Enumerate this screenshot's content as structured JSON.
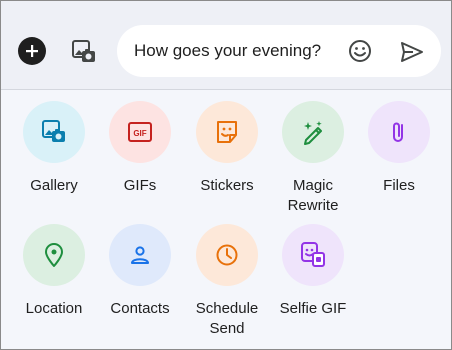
{
  "compose": {
    "message_text": "How goes your evening?",
    "icons": {
      "add": "plus-icon",
      "gallery": "gallery-icon",
      "emoji": "emoji-icon",
      "send": "send-icon"
    }
  },
  "attachments": {
    "items": [
      {
        "label": "Gallery",
        "icon": "gallery-icon",
        "bg": "#d9f1f8",
        "fg": "#0b7fae"
      },
      {
        "label": "GIFs",
        "icon": "gif-icon",
        "bg": "#fde3e2",
        "fg": "#c5221f"
      },
      {
        "label": "Stickers",
        "icon": "sticker-icon",
        "bg": "#fde8d9",
        "fg": "#e8710a"
      },
      {
        "label": "Magic\nRewrite",
        "icon": "magic-pen-icon",
        "bg": "#dcefe1",
        "fg": "#1e8e3e"
      },
      {
        "label": "Files",
        "icon": "paperclip-icon",
        "bg": "#efe4fb",
        "fg": "#9334e6"
      },
      {
        "label": "Location",
        "icon": "location-pin-icon",
        "bg": "#dcefe1",
        "fg": "#1e8e3e"
      },
      {
        "label": "Contacts",
        "icon": "contact-icon",
        "bg": "#dfe9fb",
        "fg": "#1a73e8"
      },
      {
        "label": "Schedule\nSend",
        "icon": "clock-icon",
        "bg": "#fde8d9",
        "fg": "#e8710a"
      },
      {
        "label": "Selfie GIF",
        "icon": "selfie-gif-icon",
        "bg": "#efe4fb",
        "fg": "#9334e6"
      }
    ]
  }
}
